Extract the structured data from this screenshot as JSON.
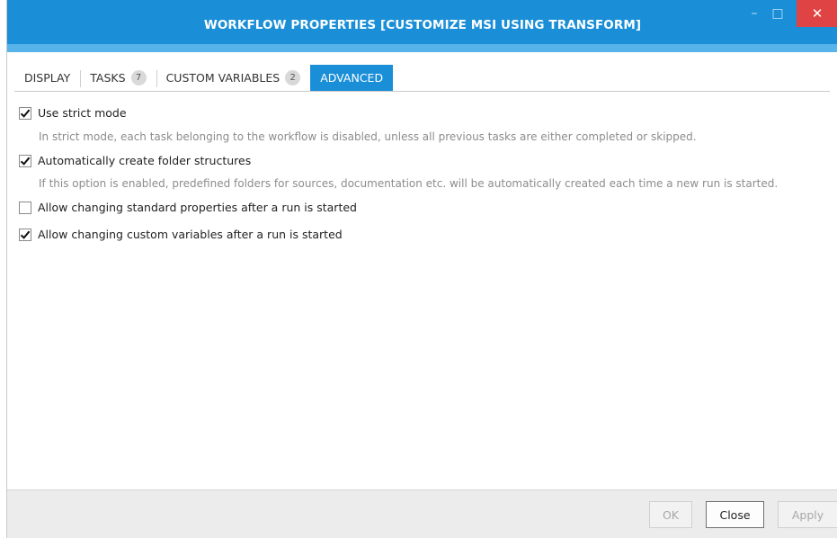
{
  "window": {
    "title": "WORKFLOW PROPERTIES [CUSTOMIZE MSI USING TRANSFORM]",
    "controls": {
      "minimize": "–",
      "maximize": "□",
      "close": "✕"
    },
    "colors": {
      "accent": "#1a8fd8",
      "close": "#e04343"
    }
  },
  "tabs": [
    {
      "label": "DISPLAY",
      "badge": null,
      "active": false
    },
    {
      "label": "TASKS",
      "badge": "7",
      "active": false
    },
    {
      "label": "CUSTOM VARIABLES",
      "badge": "2",
      "active": false
    },
    {
      "label": "ADVANCED",
      "badge": null,
      "active": true
    }
  ],
  "options": [
    {
      "label": "Use strict mode",
      "checked": true,
      "description": "In strict mode, each task belonging to the workflow is disabled, unless all previous tasks are either completed or skipped."
    },
    {
      "label": "Automatically create folder structures",
      "checked": true,
      "description": "If this option is enabled, predefined folders for sources, documentation etc. will be automatically created each time a new run is started."
    },
    {
      "label": "Allow changing standard properties after a run is started",
      "checked": false,
      "description": ""
    },
    {
      "label": "Allow changing custom variables after a run is started",
      "checked": true,
      "description": ""
    }
  ],
  "footer": {
    "ok_label": "OK",
    "close_label": "Close",
    "apply_label": "Apply"
  }
}
